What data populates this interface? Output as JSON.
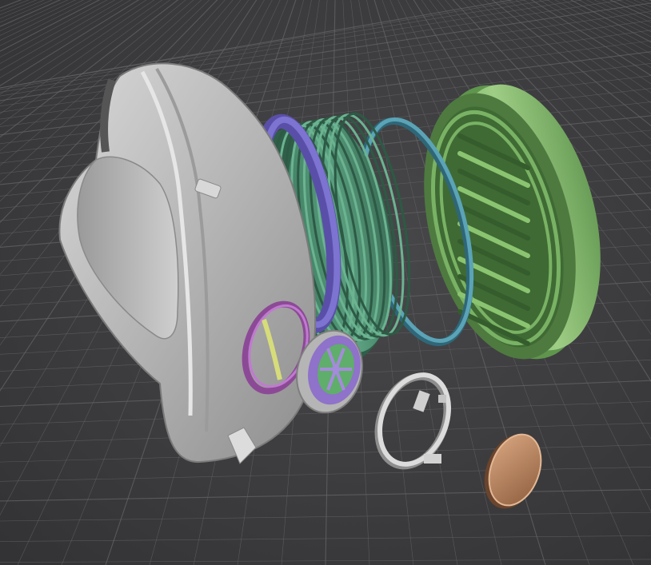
{
  "viewport": {
    "background": "#3f3f41",
    "grid_line_color": "#67676b",
    "grid_major_color": "#727276"
  },
  "parts": [
    {
      "name": "mask-shell",
      "icon": "respirator-shell",
      "color": "#bdbdbd"
    },
    {
      "name": "gasket-ring",
      "icon": "flat-ring",
      "color": "#6a5fb5"
    },
    {
      "name": "threaded-body",
      "icon": "threaded-cylinder",
      "color": "#4f9273"
    },
    {
      "name": "seal-ring",
      "icon": "o-ring",
      "color": "#4b8ea0"
    },
    {
      "name": "filter-cap",
      "icon": "slotted-cap",
      "color": "#80b56a"
    },
    {
      "name": "valve-ring",
      "icon": "small-ring",
      "color": "#a962b5"
    },
    {
      "name": "inhalation-valve",
      "icon": "valve-disc",
      "color": "#8f72c9"
    },
    {
      "name": "retainer-clip",
      "icon": "clip-ring",
      "color": "#d6d6d6"
    },
    {
      "name": "filter-disc",
      "icon": "disc",
      "color": "#b98661"
    }
  ]
}
